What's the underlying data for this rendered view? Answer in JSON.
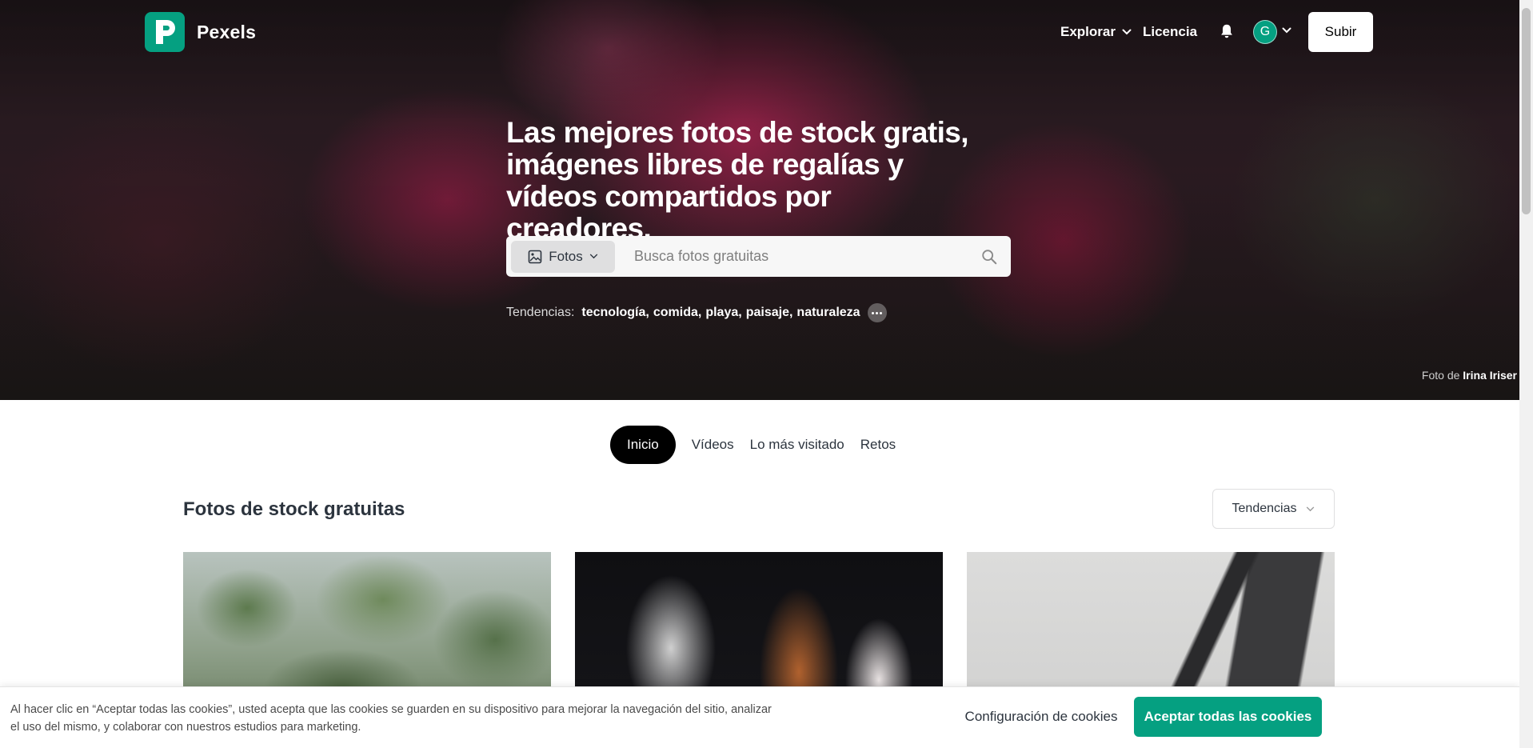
{
  "nav": {
    "logo_text": "Pexels",
    "explore_label": "Explorar",
    "license_label": "Licencia",
    "avatar_initial": "G",
    "upload_label": "Subir"
  },
  "hero": {
    "title": "Las mejores fotos de stock gratis, imágenes libres de regalías y vídeos compartidos por creadores.",
    "search": {
      "type_label": "Fotos",
      "placeholder": "Busca fotos gratuitas"
    },
    "trends_label": "Tendencias:",
    "trends": [
      "tecnología",
      "comida",
      "playa",
      "paisaje",
      "naturaleza"
    ],
    "credit_prefix": "Foto de",
    "credit_author": "Irina Iriser"
  },
  "tabs": [
    {
      "label": "Inicio",
      "active": true
    },
    {
      "label": "Vídeos",
      "active": false
    },
    {
      "label": "Lo más visitado",
      "active": false
    },
    {
      "label": "Retos",
      "active": false
    }
  ],
  "main": {
    "section_title": "Fotos de stock gratuitas",
    "sort_label": "Tendencias"
  },
  "cookie": {
    "text": "Al hacer clic en “Aceptar todas las cookies”, usted acepta que las cookies se guarden en su dispositivo para mejorar la navegación del sitio, analizar el uso del mismo, y colaborar con nuestros estudios para marketing.",
    "settings_label": "Configuración de cookies",
    "accept_label": "Aceptar todas las cookies"
  },
  "colors": {
    "brand": "#05a081",
    "text": "#2c343e"
  },
  "icons": {
    "logo": "pexels-logo-icon",
    "explore": "chevron-down-icon",
    "bell": "bell-icon",
    "search": "search-icon",
    "search_type": "image-icon",
    "more": "more-dots-icon"
  }
}
